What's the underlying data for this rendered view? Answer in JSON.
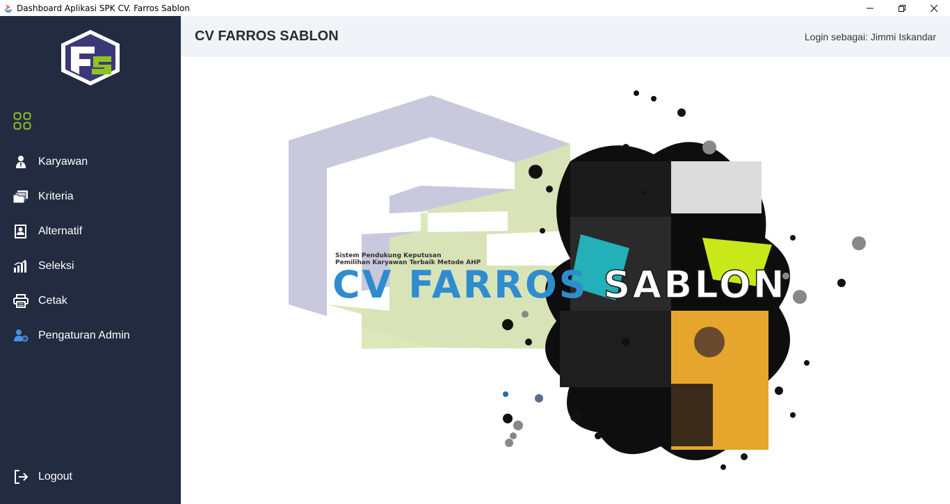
{
  "window": {
    "title": "Dashboard Aplikasi SPK CV. Farros Sablon",
    "controls": {
      "minimize": "—",
      "restore": "❐",
      "close": "✕"
    }
  },
  "sidebar": {
    "logo_text": "FS",
    "dashboard_icon": "grid-icon",
    "items": [
      {
        "label": "Karyawan",
        "icon": "person-icon"
      },
      {
        "label": "Kriteria",
        "icon": "folders-icon"
      },
      {
        "label": "Alternatif",
        "icon": "id-card-icon"
      },
      {
        "label": "Seleksi",
        "icon": "bar-chart-icon"
      },
      {
        "label": "Cetak",
        "icon": "printer-icon"
      },
      {
        "label": "Pengaturan Admin",
        "icon": "user-gear-icon"
      }
    ],
    "logout": {
      "label": "Logout",
      "icon": "logout-icon"
    }
  },
  "header": {
    "brand": "CV FARROS SABLON",
    "login_text": "Login sebagai: Jimmi Iskandar"
  },
  "hero": {
    "tagline_line1": "Sistem Pendukung Keputusan",
    "tagline_line2": "Pemilihan Karyawan Terbaik Metode AHP",
    "title_part_a": "CV FARROS",
    "title_part_b": " SABLON"
  },
  "colors": {
    "sidebar_bg": "#222b40",
    "accent_green": "#8fc31f",
    "logo_purple": "#3b3878",
    "header_bg": "#f0f4f8",
    "title_blue": "#2f8ccf"
  }
}
